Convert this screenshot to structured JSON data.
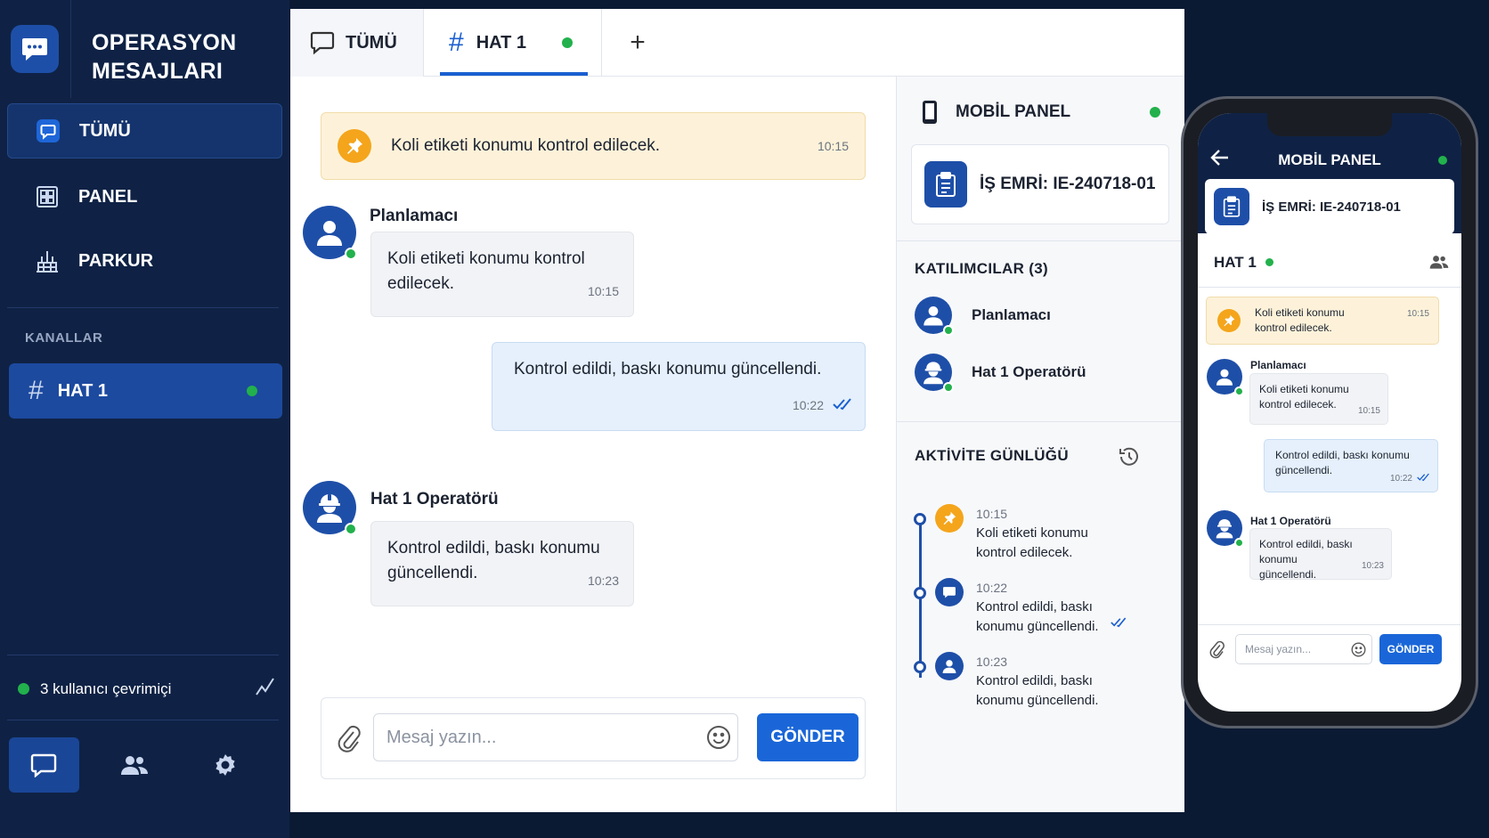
{
  "app": {
    "title_line1": "OPERASYON",
    "title_line2": "MESAJLARI"
  },
  "sidebar": {
    "nav": [
      {
        "label": "TÜMÜ",
        "icon": "chat-bubble-icon",
        "active": true
      },
      {
        "label": "PANEL",
        "icon": "dashboard-grid-icon",
        "active": false
      },
      {
        "label": "PARKUR",
        "icon": "factory-floor-icon",
        "active": false
      }
    ],
    "section_label": "KANALLAR",
    "channels": [
      {
        "label": "HAT 1",
        "icon": "hash-icon",
        "status": "online"
      }
    ],
    "online_text": "3 kullanıcı çevrimiçi",
    "bottom_nav": [
      "chat-icon",
      "users-icon",
      "settings-icon"
    ]
  },
  "tabs": [
    {
      "label": "TÜMÜ",
      "icon": "chat-bubble-icon",
      "active": false
    },
    {
      "label": "HAT 1",
      "icon": "hash-icon",
      "active": true,
      "status": "online"
    }
  ],
  "add_tab_symbol": "+",
  "pinned": {
    "text": "Koli etiketi konumu kontrol edilecek.",
    "time": "10:15"
  },
  "messages": [
    {
      "sender": "Planlamacı",
      "text": "Koli etiketi konumu kontrol edilecek.",
      "time": "10:15",
      "direction": "in",
      "avatar": "person-icon"
    },
    {
      "sender": "",
      "text": "Kontrol edildi, baskı konumu güncellendi.",
      "time": "10:22",
      "direction": "out",
      "read": true
    },
    {
      "sender": "Hat 1 Operatörü",
      "text": "Kontrol edildi, baskı konumu güncellendi.",
      "time": "10:23",
      "direction": "in",
      "avatar": "hardhat-worker-icon"
    }
  ],
  "composer": {
    "placeholder": "Mesaj yazın...",
    "send_label": "GÖNDER"
  },
  "right_panel": {
    "title": "MOBİL PANEL",
    "work_order": "İŞ EMRİ: IE-240718-01",
    "participants_title": "KATILIMCILAR (3)",
    "participants": [
      {
        "name": "Planlamacı",
        "avatar": "person-icon"
      },
      {
        "name": "Hat 1 Operatörü",
        "avatar": "hardhat-worker-icon"
      }
    ],
    "activity_title": "AKTİVİTE GÜNLÜĞÜ",
    "activity": [
      {
        "time": "10:15",
        "line1": "Koli etiketi konumu",
        "line2": "kontrol edilecek.",
        "icon": "pin-icon"
      },
      {
        "time": "10:22",
        "line1": "Kontrol edildi, baskı",
        "line2": "konumu güncellendi.",
        "icon": "chat-icon",
        "read": true
      },
      {
        "time": "10:23",
        "line1": "Kontrol edildi, baskı",
        "line2": "konumu güncellendi.",
        "icon": "person-icon"
      }
    ]
  },
  "phone": {
    "title": "MOBİL PANEL",
    "work_order": "İŞ EMRİ: IE-240718-01",
    "channel": "HAT 1",
    "pinned": {
      "line1": "Koli etiketi konumu",
      "line2": "kontrol edilecek.",
      "time": "10:15"
    },
    "messages": [
      {
        "sender": "Planlamacı",
        "line1": "Koli etiketi konumu",
        "line2": "kontrol edilecek.",
        "time": "10:15"
      },
      {
        "line1": "Kontrol edildi, baskı konumu",
        "line2": "güncellendi.",
        "time": "10:22"
      },
      {
        "sender": "Hat 1 Operatörü",
        "line1": "Kontrol edildi, baskı konumu",
        "line2": "güncellendi.",
        "time": "10:23"
      }
    ],
    "placeholder": "Mesaj yazın...",
    "send_label": "GÖNDER"
  },
  "colors": {
    "sidebar": "#0f2245",
    "accent": "#1a66d8",
    "online": "#22b14c",
    "pin": "#f4a51c",
    "pinned_bg": "#fdf2d9"
  }
}
